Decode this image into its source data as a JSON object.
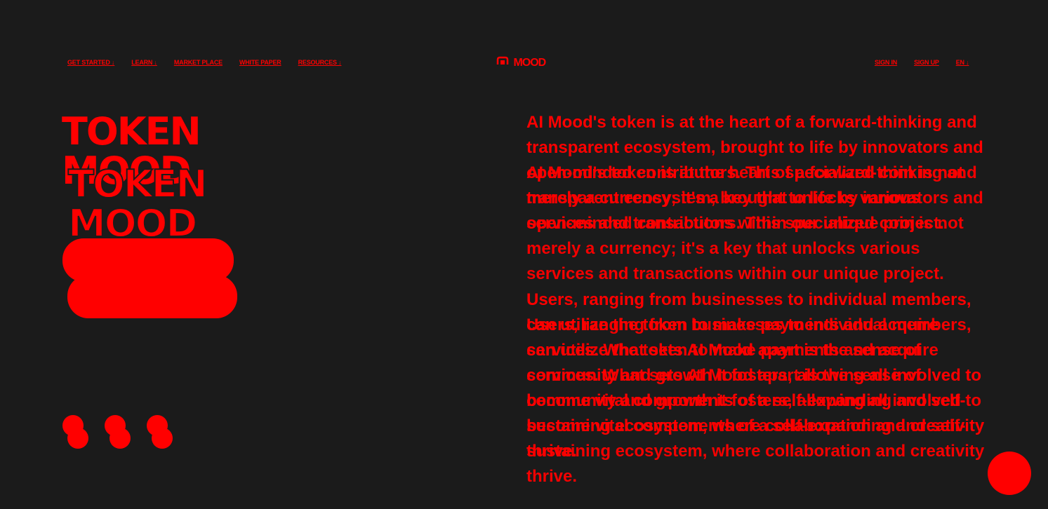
{
  "nav": {
    "left": [
      {
        "label": "GET STARTED ↓"
      },
      {
        "label": "LEARN ↓"
      },
      {
        "label": "MARKET PLACE"
      },
      {
        "label": "WHITE PAPER"
      },
      {
        "label": "RESOURCES ↓"
      }
    ],
    "logo_text": "MOOD",
    "right": [
      {
        "label": "SIGN IN"
      },
      {
        "label": "SIGN UP"
      },
      {
        "label": "EN ↓"
      }
    ]
  },
  "hero": {
    "title_line1": "TOKEN",
    "title_line2": "MOOD"
  },
  "content": {
    "paragraph1": "AI Mood's token is at the heart of a forward-thinking and transparent ecosystem, brought to life by innovators and open-minded contributors. This specialized coin is not merely a currency; it's a key that unlocks various services and transactions within our unique project.",
    "paragraph2": "Users, ranging from businesses to individual members, can utilize the token to make payments and acquire services. What sets AI Mood apart is the sense of community and growth it fosters, allowing all involved to become vital components of a self-expanding and self-sustaining ecosystem, where collaboration and creativity thrive."
  },
  "colors": {
    "background": "#1b1b1b",
    "accent": "#ff0000"
  }
}
